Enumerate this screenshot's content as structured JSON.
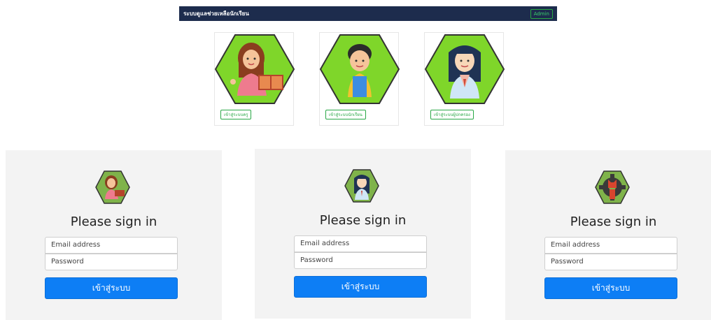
{
  "navbar": {
    "brand": "ระบบดูแลช่วยเหลือนักเรียน",
    "admin_label": "Admin"
  },
  "roles": [
    {
      "button": "เข้าสู่ระบบครู",
      "icon": "teacher-avatar-icon"
    },
    {
      "button": "เข้าสู่ระบบนักเรียน",
      "icon": "student-avatar-icon"
    },
    {
      "button": "เข้าสู่ระบบผู้ปกครอง",
      "icon": "parent-avatar-icon"
    }
  ],
  "login_forms": [
    {
      "logo": "teacher-avatar-icon",
      "title": "Please sign in",
      "email_placeholder": "Email address",
      "password_placeholder": "Password",
      "submit_label": "เข้าสู่ระบบ"
    },
    {
      "logo": "parent-avatar-icon",
      "title": "Please sign in",
      "email_placeholder": "Email address",
      "password_placeholder": "Password",
      "submit_label": "เข้าสู่ระบบ"
    },
    {
      "logo": "admin-gear-icon",
      "title": "Please sign in",
      "email_placeholder": "Email address",
      "password_placeholder": "Password",
      "submit_label": "เข้าสู่ระบบ"
    }
  ],
  "colors": {
    "navbar_bg": "#1d2c4d",
    "hex_green": "#7fd62a",
    "primary": "#0d7ef5",
    "success": "#28a745"
  }
}
